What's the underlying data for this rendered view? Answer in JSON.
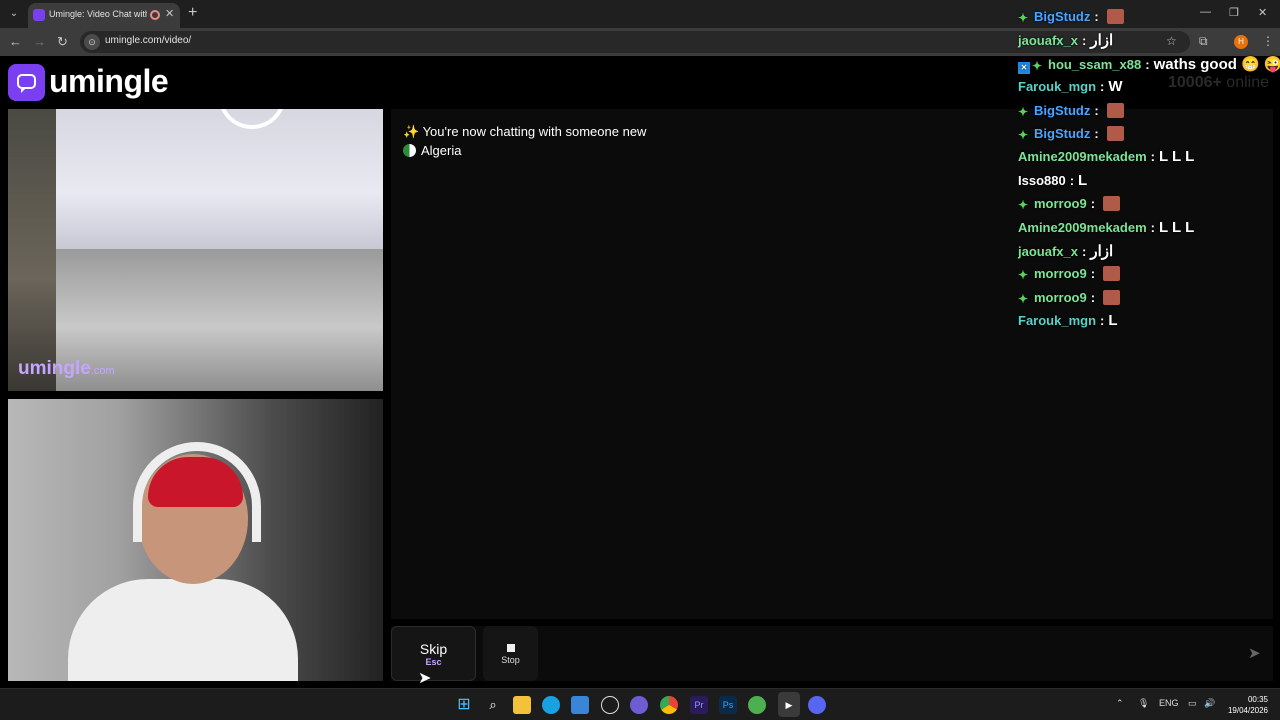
{
  "browser": {
    "tab_title": "Umingle: Video Chat with St",
    "url": "umingle.com/video/",
    "profile_initial": "H",
    "icons": [
      "tab-search-icon",
      "new-tab-icon",
      "minimize-icon",
      "maximize-icon",
      "close-icon",
      "back-icon",
      "forward-icon",
      "reload-icon",
      "site-info-icon",
      "bookmark-star-icon",
      "extensions-icon",
      "menu-kebab-icon"
    ]
  },
  "site": {
    "logo_text": "umingle",
    "online_count": "10006+",
    "online_label": "online",
    "watermark": "umingle",
    "watermark_domain": ".com"
  },
  "chat": {
    "new_partner_message": "You're now chatting with someone new",
    "country": "Algeria",
    "message_placeholder": ""
  },
  "controls": {
    "skip_label": "Skip",
    "skip_key": "Esc",
    "stop_label": "Stop"
  },
  "stream_chat": [
    {
      "user": "BigStudz",
      "sep": ":",
      "msg": "",
      "emote": true,
      "badge": "green",
      "color": "blue"
    },
    {
      "user": "jaouafx_x",
      "sep": ":",
      "msg": "ازار",
      "emote": false,
      "badge": "",
      "color": "green"
    },
    {
      "user": "hou_ssam_x88",
      "sep": ":",
      "msg": "waths good 😁 😜",
      "emote": false,
      "badge": "blue-green",
      "color": "green"
    },
    {
      "user": "Farouk_mgn",
      "sep": ":",
      "msg": "W",
      "emote": false,
      "badge": "",
      "color": "teal"
    },
    {
      "user": "BigStudz",
      "sep": ":",
      "msg": "",
      "emote": true,
      "badge": "green",
      "color": "blue"
    },
    {
      "user": "BigStudz",
      "sep": ":",
      "msg": "",
      "emote": true,
      "badge": "green",
      "color": "blue"
    },
    {
      "user": "Amine2009mekadem",
      "sep": ":",
      "msg": "L  L  L",
      "emote": false,
      "badge": "",
      "color": "green"
    },
    {
      "user": "Isso880",
      "sep": ":",
      "msg": "L",
      "emote": false,
      "badge": "",
      "color": "white"
    },
    {
      "user": "morroo9",
      "sep": ":",
      "msg": "",
      "emote": true,
      "badge": "green",
      "color": "green"
    },
    {
      "user": "Amine2009mekadem",
      "sep": ":",
      "msg": "L  L  L",
      "emote": false,
      "badge": "",
      "color": "green"
    },
    {
      "user": "jaouafx_x",
      "sep": ":",
      "msg": "ازار",
      "emote": false,
      "badge": "",
      "color": "green"
    },
    {
      "user": "morroo9",
      "sep": ":",
      "msg": "",
      "emote": true,
      "badge": "green",
      "color": "green"
    },
    {
      "user": "morroo9",
      "sep": ":",
      "msg": "",
      "emote": true,
      "badge": "green",
      "color": "green"
    },
    {
      "user": "Farouk_mgn",
      "sep": ":",
      "msg": "L",
      "emote": false,
      "badge": "",
      "color": "teal"
    }
  ],
  "taskbar": {
    "lang": "ENG",
    "time": "00:35",
    "date": "19/04/2026",
    "apps": [
      "windows-start-icon",
      "search-icon",
      "file-explorer-icon",
      "edge-icon",
      "store-icon",
      "chatgpt-icon",
      "app-icon",
      "chrome-icon",
      "premiere-icon",
      "photoshop-icon",
      "utorrent-icon",
      "media-player-icon",
      "discord-icon"
    ]
  },
  "colors": {
    "accent": "#7b3ff2",
    "watermark": "#c4a6ff"
  }
}
